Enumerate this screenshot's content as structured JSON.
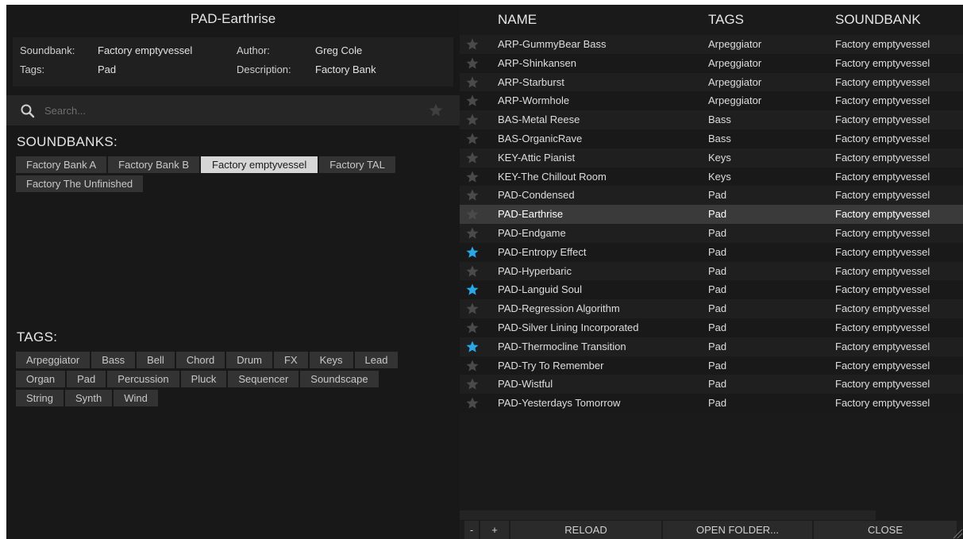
{
  "preset": {
    "title": "PAD-Earthrise",
    "soundbank_label": "Soundbank:",
    "soundbank_value": "Factory emptyvessel",
    "author_label": "Author:",
    "author_value": "Greg Cole",
    "tags_label": "Tags:",
    "tags_value": "Pad",
    "description_label": "Description:",
    "description_value": "Factory Bank"
  },
  "search": {
    "placeholder": "Search..."
  },
  "soundbanks": {
    "heading": "SOUNDBANKS:",
    "items": [
      "Factory Bank A",
      "Factory Bank B",
      "Factory emptyvessel",
      "Factory TAL",
      "Factory The Unfinished"
    ],
    "selected": "Factory emptyvessel"
  },
  "tags": {
    "heading": "TAGS:",
    "items": [
      "Arpeggiator",
      "Bass",
      "Bell",
      "Chord",
      "Drum",
      "FX",
      "Keys",
      "Lead",
      "Organ",
      "Pad",
      "Percussion",
      "Pluck",
      "Sequencer",
      "Soundscape",
      "String",
      "Synth",
      "Wind"
    ]
  },
  "table": {
    "columns": {
      "name": "NAME",
      "tags": "TAGS",
      "soundbank": "SOUNDBANK"
    },
    "rows": [
      {
        "name": "ARP-GummyBear Bass",
        "tag": "Arpeggiator",
        "bank": "Factory emptyvessel",
        "fav": false
      },
      {
        "name": "ARP-Shinkansen",
        "tag": "Arpeggiator",
        "bank": "Factory emptyvessel",
        "fav": false
      },
      {
        "name": "ARP-Starburst",
        "tag": "Arpeggiator",
        "bank": "Factory emptyvessel",
        "fav": false
      },
      {
        "name": "ARP-Wormhole",
        "tag": "Arpeggiator",
        "bank": "Factory emptyvessel",
        "fav": false
      },
      {
        "name": "BAS-Metal Reese",
        "tag": "Bass",
        "bank": "Factory emptyvessel",
        "fav": false
      },
      {
        "name": "BAS-OrganicRave",
        "tag": "Bass",
        "bank": "Factory emptyvessel",
        "fav": false
      },
      {
        "name": "KEY-Attic Pianist",
        "tag": "Keys",
        "bank": "Factory emptyvessel",
        "fav": false
      },
      {
        "name": "KEY-The Chillout Room",
        "tag": "Keys",
        "bank": "Factory emptyvessel",
        "fav": false
      },
      {
        "name": "PAD-Condensed",
        "tag": "Pad",
        "bank": "Factory emptyvessel",
        "fav": false
      },
      {
        "name": "PAD-Earthrise",
        "tag": "Pad",
        "bank": "Factory emptyvessel",
        "fav": false,
        "selected": true
      },
      {
        "name": "PAD-Endgame",
        "tag": "Pad",
        "bank": "Factory emptyvessel",
        "fav": false
      },
      {
        "name": "PAD-Entropy Effect",
        "tag": "Pad",
        "bank": "Factory emptyvessel",
        "fav": true
      },
      {
        "name": "PAD-Hyperbaric",
        "tag": "Pad",
        "bank": "Factory emptyvessel",
        "fav": false
      },
      {
        "name": "PAD-Languid Soul",
        "tag": "Pad",
        "bank": "Factory emptyvessel",
        "fav": true
      },
      {
        "name": "PAD-Regression Algorithm",
        "tag": "Pad",
        "bank": "Factory emptyvessel",
        "fav": false
      },
      {
        "name": "PAD-Silver Lining Incorporated",
        "tag": "Pad",
        "bank": "Factory emptyvessel",
        "fav": false
      },
      {
        "name": "PAD-Thermocline Transition",
        "tag": "Pad",
        "bank": "Factory emptyvessel",
        "fav": true
      },
      {
        "name": "PAD-Try To Remember",
        "tag": "Pad",
        "bank": "Factory emptyvessel",
        "fav": false
      },
      {
        "name": "PAD-Wistful",
        "tag": "Pad",
        "bank": "Factory emptyvessel",
        "fav": false
      },
      {
        "name": "PAD-Yesterdays Tomorrow",
        "tag": "Pad",
        "bank": "Factory emptyvessel",
        "fav": false
      }
    ]
  },
  "bottom_bar": {
    "minus_label": "-",
    "plus_label": "+",
    "reload_label": "RELOAD",
    "open_folder_label": "OPEN FOLDER...",
    "close_label": "CLOSE"
  },
  "colors": {
    "fav_star": "#29a8e8",
    "inactive_star": "#4a4a4a",
    "selected_chip": "#d6d6d6",
    "selected_row": "#3a3a3a"
  },
  "icons": {
    "search": "search-icon",
    "star": "star-icon",
    "resize": "resize-grip-icon"
  }
}
